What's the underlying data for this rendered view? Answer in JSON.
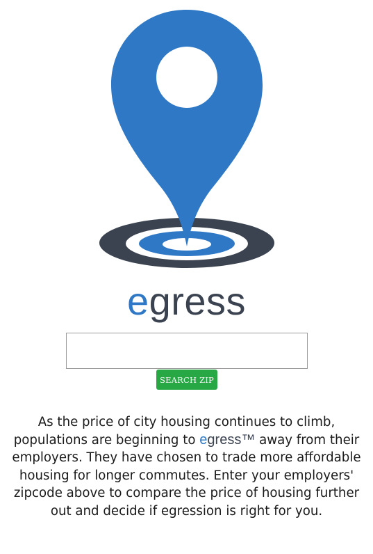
{
  "brand": {
    "logo_icon": "map-pin-icon",
    "wordmark_accent": "e",
    "wordmark_rest": "gress",
    "accent_color": "#2e78c6",
    "dark_color": "#3b4350"
  },
  "search": {
    "input_value": "",
    "button_label": "SEARCH ZIP",
    "button_color": "#28a745"
  },
  "description": {
    "before": "As the price of city housing continues to climb, populations are beginning to ",
    "brand_accent": "e",
    "brand_rest": "gress",
    "trademark": "™",
    "after": " away from their employers. They have chosen to trade more affordable housing for longer commutes. Enter your employers' zipcode above to compare the price of housing further out and decide if egression is right for you."
  }
}
